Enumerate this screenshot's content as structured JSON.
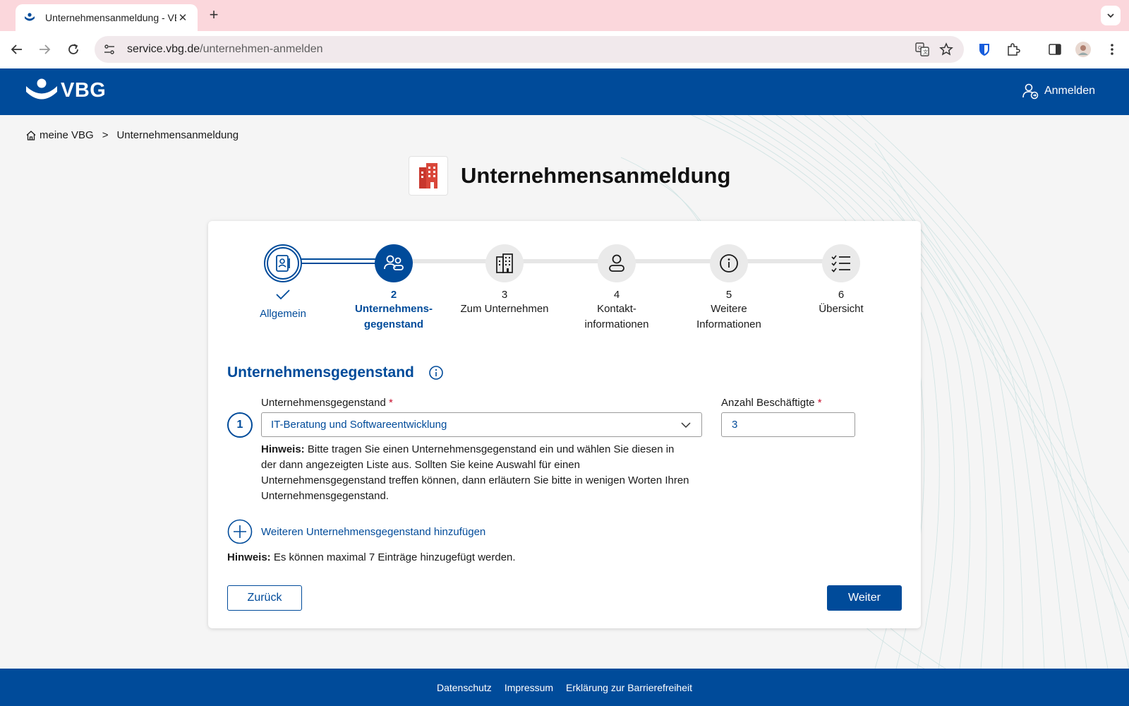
{
  "browser": {
    "tab_title": "Unternehmensanmeldung - VBG",
    "url_host": "service.vbg.de",
    "url_path": "/unternehmen-anmelden"
  },
  "header": {
    "logo_text": "VBG",
    "login_label": "Anmelden"
  },
  "breadcrumb": {
    "home": "meine VBG",
    "separator": ">",
    "current": "Unternehmensanmeldung"
  },
  "page": {
    "title": "Unternehmensanmeldung"
  },
  "stepper": {
    "steps": [
      {
        "number": "",
        "label": "Allgemein",
        "state": "done"
      },
      {
        "number": "2",
        "label": "Unternehmens-\ngegenstand",
        "state": "active"
      },
      {
        "number": "3",
        "label": "Zum Unternehmen",
        "state": "todo"
      },
      {
        "number": "4",
        "label": "Kontakt-\ninformationen",
        "state": "todo"
      },
      {
        "number": "5",
        "label": "Weitere\nInformationen",
        "state": "todo"
      },
      {
        "number": "6",
        "label": "Übersicht",
        "state": "todo"
      }
    ]
  },
  "form": {
    "section_title": "Unternehmensgegenstand",
    "entry_number": "1",
    "subject_label": "Unternehmensgegenstand",
    "subject_value": "IT-Beratung und Softwareentwicklung",
    "employees_label": "Anzahl Beschäftigte",
    "employees_value": "3",
    "required_mark": "*",
    "hint_label": "Hinweis:",
    "hint_text": "Bitte tragen Sie einen Unternehmensgegenstand ein und wählen Sie diesen in der dann angezeigten Liste aus. Sollten Sie keine Auswahl für einen Unternehmensgegenstand treffen können, dann erläutern Sie bitte in wenigen Worten Ihren Unternehmensgegenstand.",
    "add_label": "Weiteren Unternehmensgegenstand hinzufügen",
    "max_hint_label": "Hinweis:",
    "max_hint_text": "Es können maximal 7 Einträge hinzugefügt werden.",
    "back_label": "Zurück",
    "next_label": "Weiter"
  },
  "footer": {
    "links": [
      "Datenschutz",
      "Impressum",
      "Erklärung zur Barrierefreiheit"
    ]
  },
  "colors": {
    "brand": "#004b9a",
    "required": "#c8102e",
    "building_icon": "#c8372d"
  }
}
